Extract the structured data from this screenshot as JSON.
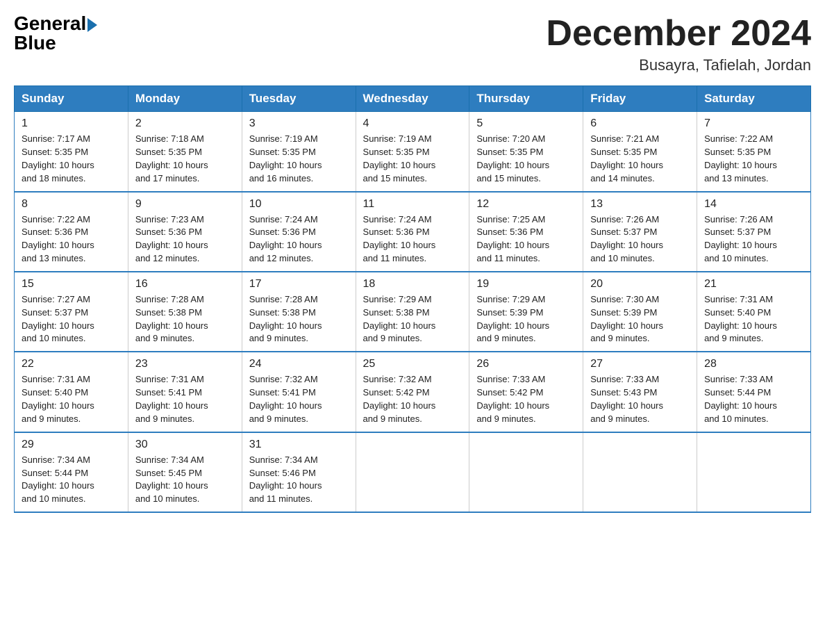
{
  "header": {
    "title": "December 2024",
    "location": "Busayra, Tafielah, Jordan",
    "logo_general": "General",
    "logo_blue": "Blue"
  },
  "columns": [
    "Sunday",
    "Monday",
    "Tuesday",
    "Wednesday",
    "Thursday",
    "Friday",
    "Saturday"
  ],
  "weeks": [
    [
      {
        "day": "1",
        "sunrise": "7:17 AM",
        "sunset": "5:35 PM",
        "daylight": "10 hours and 18 minutes."
      },
      {
        "day": "2",
        "sunrise": "7:18 AM",
        "sunset": "5:35 PM",
        "daylight": "10 hours and 17 minutes."
      },
      {
        "day": "3",
        "sunrise": "7:19 AM",
        "sunset": "5:35 PM",
        "daylight": "10 hours and 16 minutes."
      },
      {
        "day": "4",
        "sunrise": "7:19 AM",
        "sunset": "5:35 PM",
        "daylight": "10 hours and 15 minutes."
      },
      {
        "day": "5",
        "sunrise": "7:20 AM",
        "sunset": "5:35 PM",
        "daylight": "10 hours and 15 minutes."
      },
      {
        "day": "6",
        "sunrise": "7:21 AM",
        "sunset": "5:35 PM",
        "daylight": "10 hours and 14 minutes."
      },
      {
        "day": "7",
        "sunrise": "7:22 AM",
        "sunset": "5:35 PM",
        "daylight": "10 hours and 13 minutes."
      }
    ],
    [
      {
        "day": "8",
        "sunrise": "7:22 AM",
        "sunset": "5:36 PM",
        "daylight": "10 hours and 13 minutes."
      },
      {
        "day": "9",
        "sunrise": "7:23 AM",
        "sunset": "5:36 PM",
        "daylight": "10 hours and 12 minutes."
      },
      {
        "day": "10",
        "sunrise": "7:24 AM",
        "sunset": "5:36 PM",
        "daylight": "10 hours and 12 minutes."
      },
      {
        "day": "11",
        "sunrise": "7:24 AM",
        "sunset": "5:36 PM",
        "daylight": "10 hours and 11 minutes."
      },
      {
        "day": "12",
        "sunrise": "7:25 AM",
        "sunset": "5:36 PM",
        "daylight": "10 hours and 11 minutes."
      },
      {
        "day": "13",
        "sunrise": "7:26 AM",
        "sunset": "5:37 PM",
        "daylight": "10 hours and 10 minutes."
      },
      {
        "day": "14",
        "sunrise": "7:26 AM",
        "sunset": "5:37 PM",
        "daylight": "10 hours and 10 minutes."
      }
    ],
    [
      {
        "day": "15",
        "sunrise": "7:27 AM",
        "sunset": "5:37 PM",
        "daylight": "10 hours and 10 minutes."
      },
      {
        "day": "16",
        "sunrise": "7:28 AM",
        "sunset": "5:38 PM",
        "daylight": "10 hours and 9 minutes."
      },
      {
        "day": "17",
        "sunrise": "7:28 AM",
        "sunset": "5:38 PM",
        "daylight": "10 hours and 9 minutes."
      },
      {
        "day": "18",
        "sunrise": "7:29 AM",
        "sunset": "5:38 PM",
        "daylight": "10 hours and 9 minutes."
      },
      {
        "day": "19",
        "sunrise": "7:29 AM",
        "sunset": "5:39 PM",
        "daylight": "10 hours and 9 minutes."
      },
      {
        "day": "20",
        "sunrise": "7:30 AM",
        "sunset": "5:39 PM",
        "daylight": "10 hours and 9 minutes."
      },
      {
        "day": "21",
        "sunrise": "7:31 AM",
        "sunset": "5:40 PM",
        "daylight": "10 hours and 9 minutes."
      }
    ],
    [
      {
        "day": "22",
        "sunrise": "7:31 AM",
        "sunset": "5:40 PM",
        "daylight": "10 hours and 9 minutes."
      },
      {
        "day": "23",
        "sunrise": "7:31 AM",
        "sunset": "5:41 PM",
        "daylight": "10 hours and 9 minutes."
      },
      {
        "day": "24",
        "sunrise": "7:32 AM",
        "sunset": "5:41 PM",
        "daylight": "10 hours and 9 minutes."
      },
      {
        "day": "25",
        "sunrise": "7:32 AM",
        "sunset": "5:42 PM",
        "daylight": "10 hours and 9 minutes."
      },
      {
        "day": "26",
        "sunrise": "7:33 AM",
        "sunset": "5:42 PM",
        "daylight": "10 hours and 9 minutes."
      },
      {
        "day": "27",
        "sunrise": "7:33 AM",
        "sunset": "5:43 PM",
        "daylight": "10 hours and 9 minutes."
      },
      {
        "day": "28",
        "sunrise": "7:33 AM",
        "sunset": "5:44 PM",
        "daylight": "10 hours and 10 minutes."
      }
    ],
    [
      {
        "day": "29",
        "sunrise": "7:34 AM",
        "sunset": "5:44 PM",
        "daylight": "10 hours and 10 minutes."
      },
      {
        "day": "30",
        "sunrise": "7:34 AM",
        "sunset": "5:45 PM",
        "daylight": "10 hours and 10 minutes."
      },
      {
        "day": "31",
        "sunrise": "7:34 AM",
        "sunset": "5:46 PM",
        "daylight": "10 hours and 11 minutes."
      },
      {
        "day": "",
        "sunrise": "",
        "sunset": "",
        "daylight": ""
      },
      {
        "day": "",
        "sunrise": "",
        "sunset": "",
        "daylight": ""
      },
      {
        "day": "",
        "sunrise": "",
        "sunset": "",
        "daylight": ""
      },
      {
        "day": "",
        "sunrise": "",
        "sunset": "",
        "daylight": ""
      }
    ]
  ],
  "label_sunrise": "Sunrise: ",
  "label_sunset": "Sunset: ",
  "label_daylight": "Daylight: "
}
